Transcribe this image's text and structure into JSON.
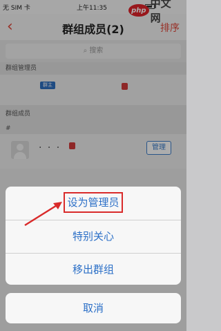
{
  "status_bar": {
    "carrier": "无 SIM 卡",
    "time": "上午11:35"
  },
  "watermark": {
    "logo": "php",
    "text": "中文网"
  },
  "nav": {
    "back_icon": "chevron-left-icon",
    "title": "群组成员(2)",
    "sort_label": "排序"
  },
  "search": {
    "placeholder": "搜索"
  },
  "admins_section": {
    "title": "群组管理员",
    "owner_badge": "群主"
  },
  "members_section": {
    "title": "群组成员",
    "index_letter": "#",
    "member_name": "· · ·",
    "manage_label": "管理"
  },
  "action_sheet": {
    "items": [
      "设为管理员",
      "特别关心",
      "移出群组"
    ],
    "cancel_label": "取消"
  },
  "colors": {
    "accent": "#e0483a",
    "action_blue": "#2b6fc7",
    "highlight_red": "#d92a2a"
  }
}
